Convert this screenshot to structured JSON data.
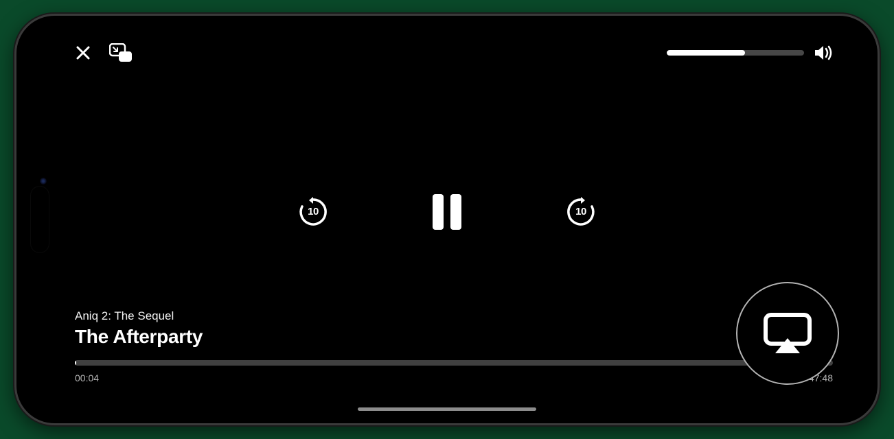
{
  "player": {
    "episode_title": "Aniq 2: The Sequel",
    "show_title": "The Afterparty",
    "elapsed": "00:04",
    "remaining": "−47:48",
    "progress_percent": 0.15
  },
  "controls": {
    "skip_back_seconds": "10",
    "skip_forward_seconds": "10"
  },
  "volume": {
    "level_percent": 57
  },
  "icons": {
    "close": "close-icon",
    "pip": "picture-in-picture-icon",
    "speaker": "speaker-icon",
    "airplay": "airplay-icon",
    "more": "more-icon"
  }
}
